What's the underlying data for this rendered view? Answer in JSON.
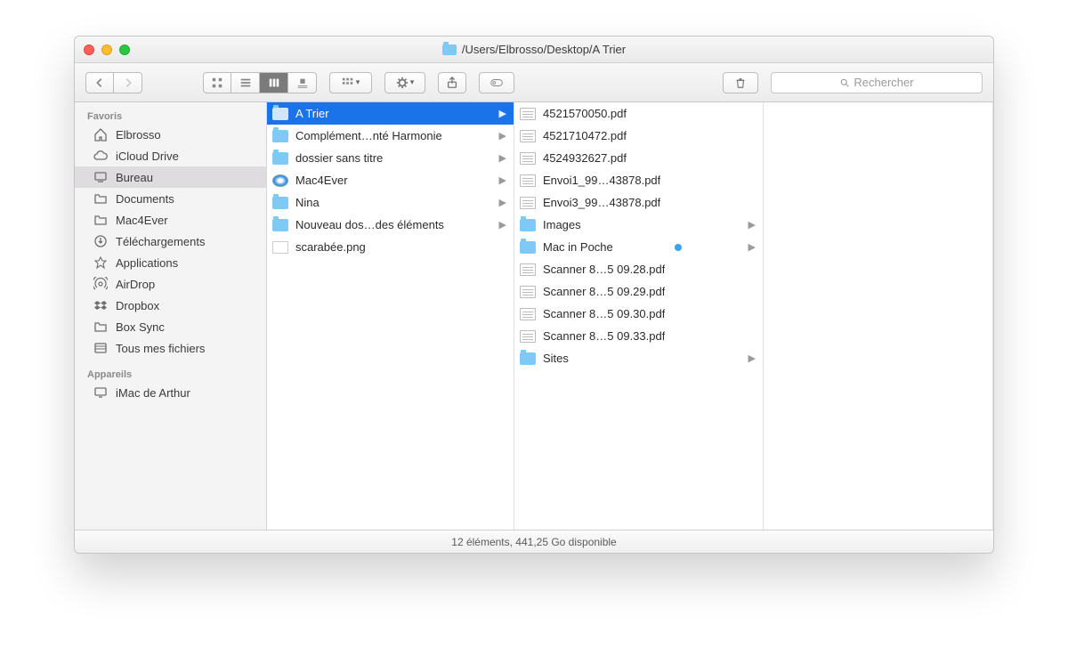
{
  "window": {
    "title_path": "/Users/Elbrosso/Desktop/A Trier"
  },
  "toolbar": {
    "search_placeholder": "Rechercher"
  },
  "sidebar": {
    "section_favorites": "Favoris",
    "section_devices": "Appareils",
    "favorites": [
      {
        "label": "Elbrosso",
        "icon": "home"
      },
      {
        "label": "iCloud Drive",
        "icon": "cloud"
      },
      {
        "label": "Bureau",
        "icon": "desktop",
        "selected": true
      },
      {
        "label": "Documents",
        "icon": "folder"
      },
      {
        "label": "Mac4Ever",
        "icon": "folder"
      },
      {
        "label": "Téléchargements",
        "icon": "download"
      },
      {
        "label": "Applications",
        "icon": "apps"
      },
      {
        "label": "AirDrop",
        "icon": "airdrop"
      },
      {
        "label": "Dropbox",
        "icon": "dropbox"
      },
      {
        "label": "Box Sync",
        "icon": "folder"
      },
      {
        "label": "Tous mes fichiers",
        "icon": "all"
      }
    ],
    "devices": [
      {
        "label": "iMac de Arthur",
        "icon": "imac"
      }
    ]
  },
  "column1": [
    {
      "label": "A Trier",
      "type": "folder",
      "arrow": true,
      "selected": true
    },
    {
      "label": "Complément…nté Harmonie",
      "type": "folder",
      "arrow": true
    },
    {
      "label": "dossier sans titre",
      "type": "folder",
      "arrow": true
    },
    {
      "label": "Mac4Ever",
      "type": "safari",
      "arrow": true
    },
    {
      "label": "Nina",
      "type": "folder",
      "arrow": true
    },
    {
      "label": "Nouveau dos…des éléments",
      "type": "folder",
      "arrow": true
    },
    {
      "label": "scarabée.png",
      "type": "img"
    }
  ],
  "column2": [
    {
      "label": "4521570050.pdf",
      "type": "file"
    },
    {
      "label": "4521710472.pdf",
      "type": "file"
    },
    {
      "label": "4524932627.pdf",
      "type": "file"
    },
    {
      "label": "Envoi1_99…43878.pdf",
      "type": "file"
    },
    {
      "label": "Envoi3_99…43878.pdf",
      "type": "file"
    },
    {
      "label": "Images",
      "type": "folder",
      "arrow": true
    },
    {
      "label": "Mac in Poche",
      "type": "folder",
      "arrow": true,
      "tag": "blue"
    },
    {
      "label": "Scanner 8…5 09.28.pdf",
      "type": "file"
    },
    {
      "label": "Scanner 8…5 09.29.pdf",
      "type": "file"
    },
    {
      "label": "Scanner 8…5 09.30.pdf",
      "type": "file"
    },
    {
      "label": "Scanner 8…5 09.33.pdf",
      "type": "file"
    },
    {
      "label": "Sites",
      "type": "folder",
      "arrow": true
    }
  ],
  "status": "12 éléments, 441,25 Go disponible"
}
